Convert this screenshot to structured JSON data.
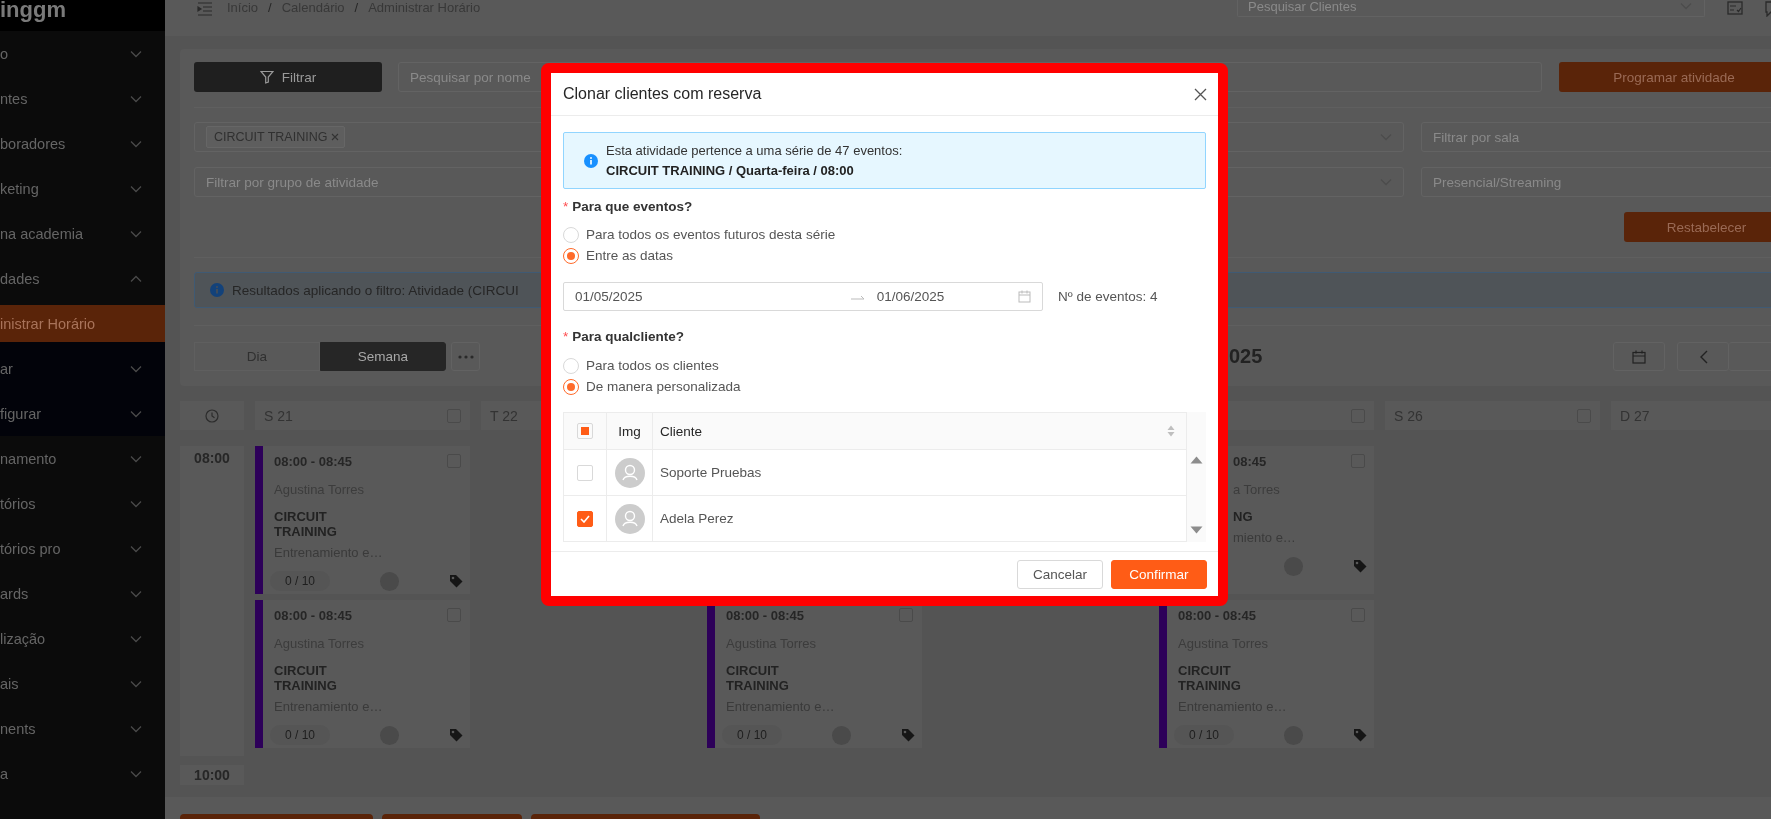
{
  "sidebar": {
    "logo": "inggm",
    "items": [
      {
        "label": "o",
        "expanded": false,
        "selected": false
      },
      {
        "label": "ntes",
        "expanded": false,
        "selected": false
      },
      {
        "label": "boradores",
        "expanded": false,
        "selected": false
      },
      {
        "label": "keting",
        "expanded": false,
        "selected": false
      },
      {
        "label": "na academia",
        "expanded": false,
        "selected": false
      },
      {
        "label": "dades",
        "expanded": true,
        "selected": false,
        "children": [
          {
            "label": "inistrar Horário",
            "selected": true
          },
          {
            "label": "ar",
            "expanded": false,
            "selected": false
          },
          {
            "label": "figurar",
            "expanded": false,
            "selected": false
          }
        ]
      },
      {
        "label": "namento",
        "expanded": false,
        "selected": false
      },
      {
        "label": "tórios",
        "expanded": false,
        "selected": false
      },
      {
        "label": "tórios pro",
        "expanded": false,
        "selected": false
      },
      {
        "label": "ards",
        "expanded": false,
        "selected": false
      },
      {
        "label": "lização",
        "expanded": false,
        "selected": false
      },
      {
        "label": "ais",
        "expanded": false,
        "selected": false
      },
      {
        "label": "nents",
        "expanded": false,
        "selected": false
      },
      {
        "label": "a",
        "expanded": false,
        "selected": false
      }
    ]
  },
  "top_bar": {
    "breadcrumb": {
      "items": [
        "Início",
        "Calendário",
        "Administrar Horário"
      ],
      "separator": "/"
    },
    "client_search": {
      "placeholder": "Pesquisar Clientes"
    }
  },
  "filters": {
    "filter_button": "Filtrar",
    "name_search": {
      "placeholder": "Pesquisar por nome"
    },
    "program_button": "Programar atividade",
    "activity_tags": [
      "CIRCUIT TRAINING"
    ],
    "group_filter": {
      "placeholder": "Filtrar por grupo de atividade"
    },
    "room_filter": {
      "placeholder": "Filtrar por sala"
    },
    "mode_filter": {
      "placeholder": "Presencial/Streaming"
    },
    "reset_button": "Restabelecer",
    "results_alert": "Resultados aplicando o filtro: Atividade (CIRCUI"
  },
  "view": {
    "tabs": [
      {
        "label": "Dia",
        "selected": false
      },
      {
        "label": "Semana",
        "selected": true
      }
    ],
    "title": "025"
  },
  "calendar": {
    "times": [
      "08:00",
      "10:00"
    ],
    "days": [
      {
        "kind": "day",
        "label": "S 21",
        "checked": false,
        "events": [
          {
            "kind": "event",
            "time": "08:00 - 08:45",
            "instructor": "Agustina Torres",
            "title": "CIRCUIT TRAINING",
            "description": "Entrenamiento e…",
            "capacity": "0 / 10",
            "checked": false
          },
          {
            "kind": "event",
            "time": "08:00 - 08:45",
            "instructor": "Agustina Torres",
            "title": "CIRCUIT TRAINING",
            "description": "Entrenamiento e…",
            "capacity": "0 / 10",
            "checked": false
          }
        ]
      },
      {
        "kind": "day",
        "label": "T 22"
      },
      {
        "kind": "covered",
        "events": [
          {
            "kind": "covered"
          },
          {
            "kind": "event",
            "time": "08:00 - 08:45",
            "instructor": "Agustina Torres",
            "title": "CIRCUIT TRAINING",
            "description": "Entrenamiento e…",
            "capacity": "0 / 10",
            "checked": false
          }
        ]
      },
      {
        "kind": "covered"
      },
      {
        "kind": "day",
        "checked": false,
        "events": [
          {
            "kind": "partial",
            "time": "08:45",
            "instructor": "a Torres",
            "title": "NG",
            "description": "miento e…",
            "checked": false
          },
          {
            "kind": "event",
            "time": "08:00 - 08:45",
            "instructor": "Agustina Torres",
            "title": "CIRCUIT TRAINING",
            "description": "Entrenamiento e…",
            "capacity": "0 / 10",
            "checked": false
          }
        ]
      },
      {
        "kind": "day",
        "label": "S 26",
        "checked": false
      },
      {
        "kind": "day",
        "label": "D 27"
      }
    ]
  },
  "dialog": {
    "title": "Clonar clientes com reserva",
    "info": {
      "text": "Esta atividade pertence a uma série de 47 eventos:",
      "detail": "CIRCUIT TRAINING / Quarta-feira / 08:00"
    },
    "event_scope": {
      "required_mark": "*",
      "label": "Para que eventos?",
      "options": [
        {
          "label": "Para todos os eventos futuros desta série",
          "selected": false
        },
        {
          "label": "Entre as datas",
          "selected": true
        }
      ]
    },
    "date_range": {
      "start": "01/05/2025",
      "end": "01/06/2025"
    },
    "event_count": "Nº de eventos: 4",
    "client_scope": {
      "required_mark": "*",
      "label": "Para qualcliente?",
      "options": [
        {
          "label": "Para todos os clientes",
          "selected": false
        },
        {
          "label": "De manera personalizada",
          "selected": true
        }
      ]
    },
    "clients_table": {
      "select_all_indeterminate": true,
      "columns": [
        "Img",
        "Cliente"
      ],
      "rows": [
        {
          "checked": false,
          "name": "Soporte Pruebas"
        },
        {
          "checked": true,
          "name": "Adela Perez"
        }
      ]
    },
    "buttons": [
      {
        "kind": "secondary",
        "label": "Cancelar"
      },
      {
        "kind": "primary",
        "label": "Confirmar"
      }
    ]
  }
}
